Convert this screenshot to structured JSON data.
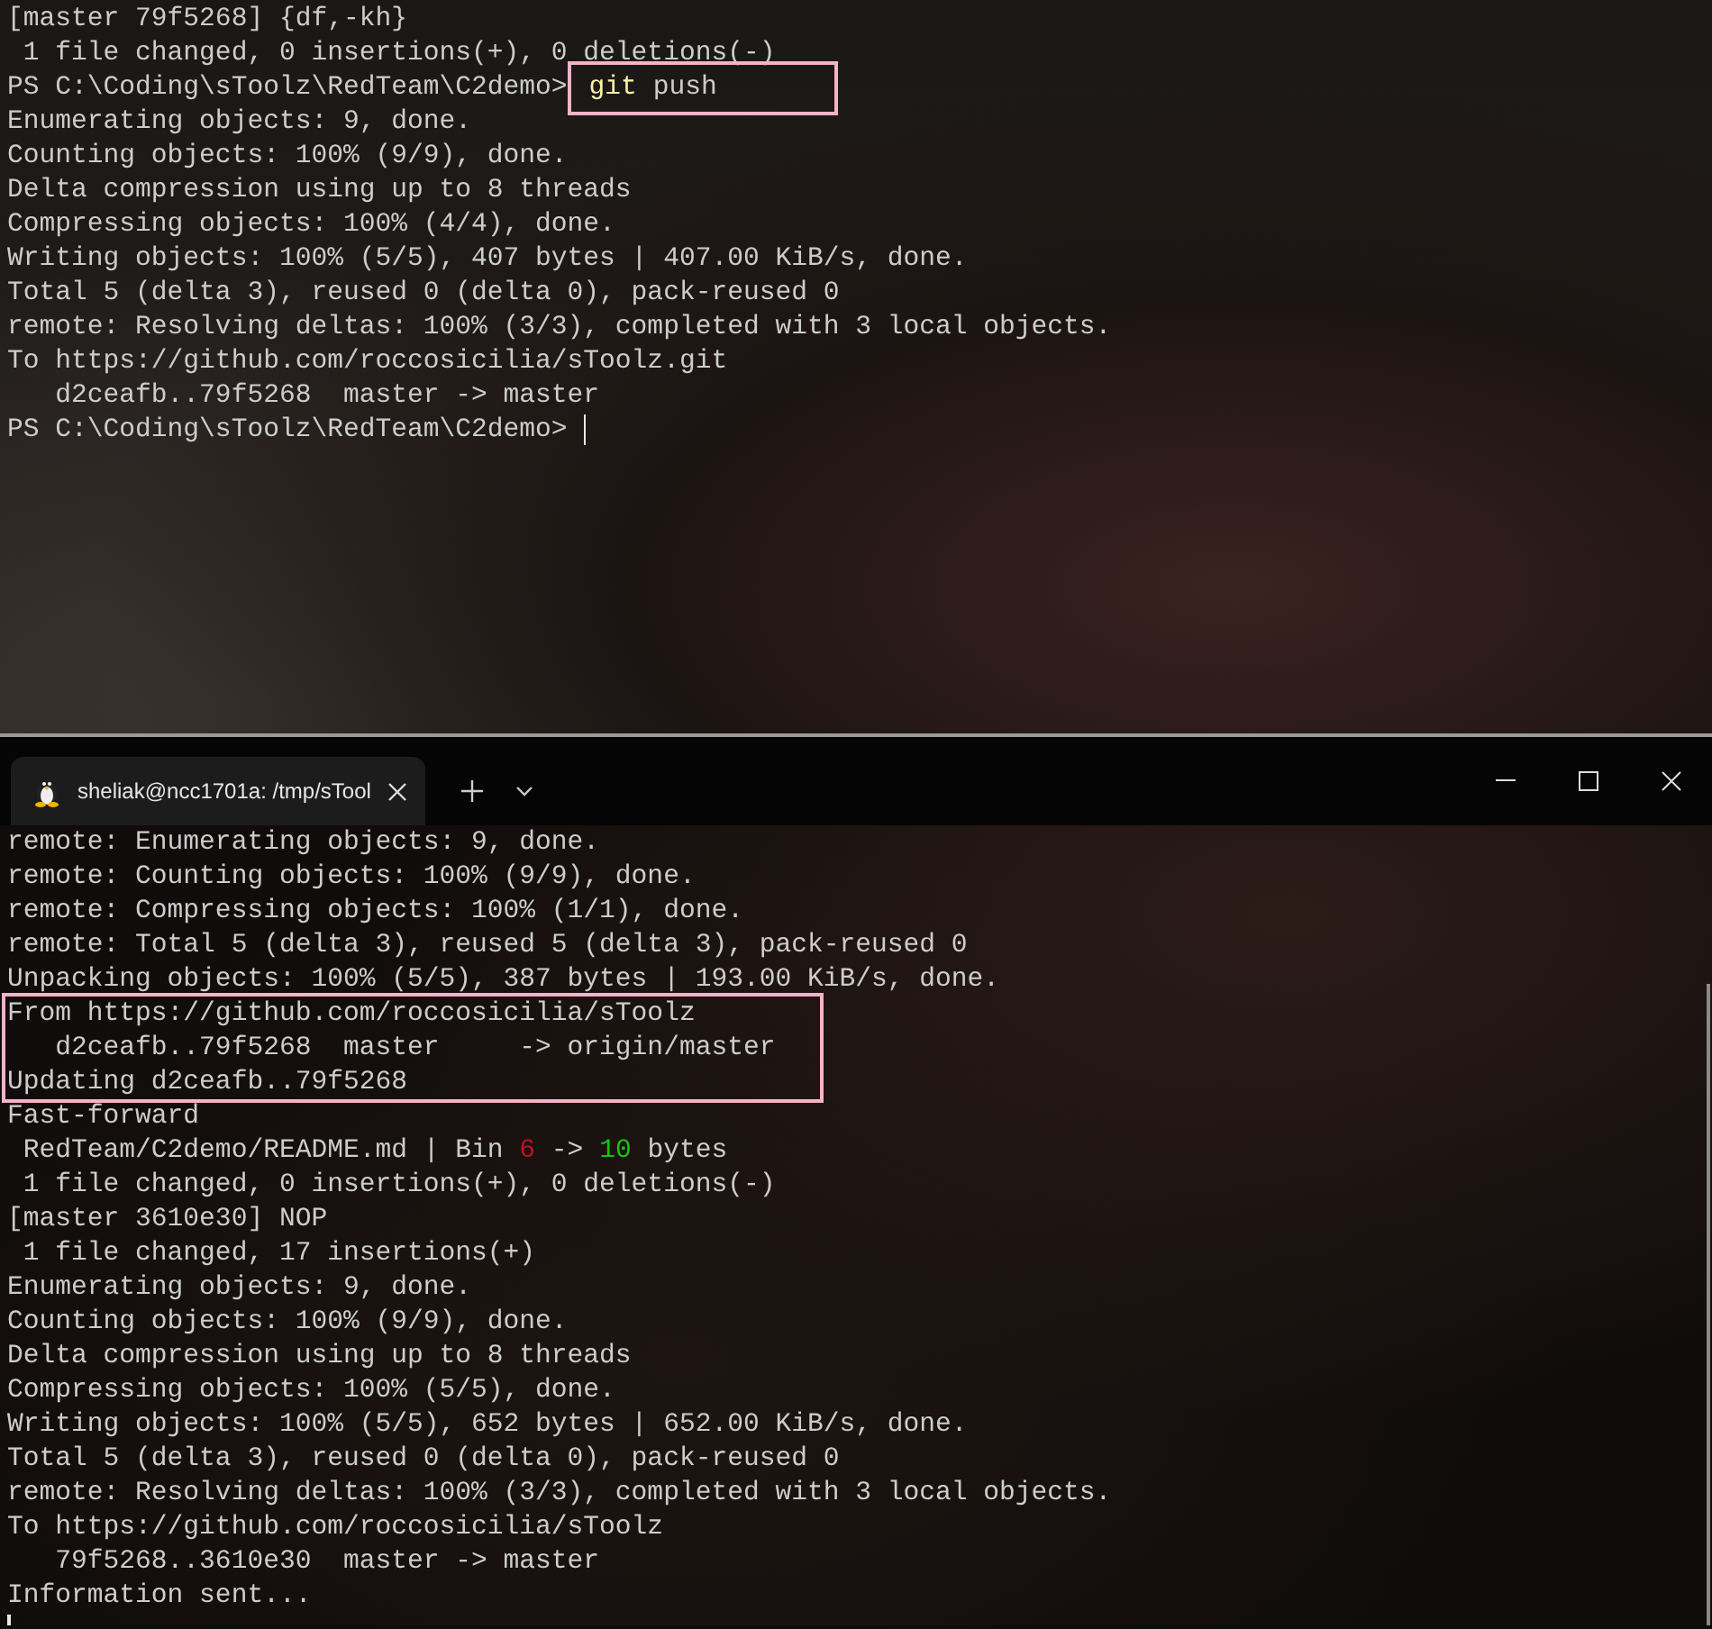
{
  "top_terminal": {
    "lines": [
      {
        "segments": [
          {
            "text": "[master 79f5268] {df,-kh}",
            "kind": "plain"
          }
        ]
      },
      {
        "segments": [
          {
            "text": " 1 file changed, 0 insertions(+), 0 deletions(-)",
            "kind": "plain"
          }
        ]
      },
      {
        "prompt": "PS C:\\Coding\\sToolz\\RedTeam\\C2demo>",
        "command": [
          {
            "text": "git",
            "kind": "executable"
          },
          {
            "text": "push",
            "kind": "argument"
          }
        ],
        "boxed": true
      },
      {
        "segments": [
          {
            "text": "Enumerating objects: 9, done.",
            "kind": "plain"
          }
        ]
      },
      {
        "segments": [
          {
            "text": "Counting objects: 100% (9/9), done.",
            "kind": "plain"
          }
        ]
      },
      {
        "segments": [
          {
            "text": "Delta compression using up to 8 threads",
            "kind": "plain"
          }
        ]
      },
      {
        "segments": [
          {
            "text": "Compressing objects: 100% (4/4), done.",
            "kind": "plain"
          }
        ]
      },
      {
        "segments": [
          {
            "text": "Writing objects: 100% (5/5), 407 bytes | 407.00 KiB/s, done.",
            "kind": "plain"
          }
        ]
      },
      {
        "segments": [
          {
            "text": "Total 5 (delta 3), reused 0 (delta 0), pack-reused 0",
            "kind": "plain"
          }
        ]
      },
      {
        "segments": [
          {
            "text": "remote: Resolving deltas: 100% (3/3), completed with 3 local objects.",
            "kind": "plain"
          }
        ]
      },
      {
        "segments": [
          {
            "text": "To https://github.com/roccosicilia/sToolz.git",
            "kind": "plain"
          }
        ]
      },
      {
        "segments": [
          {
            "text": "   d2ceafb..79f5268  master -> master",
            "kind": "plain"
          }
        ]
      },
      {
        "segments": [
          {
            "text": "PS C:\\Coding\\sToolz\\RedTeam\\C2demo> ",
            "kind": "plain"
          }
        ],
        "cursor": true
      }
    ]
  },
  "bottom_window": {
    "tab": {
      "title": "sheliak@ncc1701a: /tmp/sTool",
      "selected": true
    },
    "lines": [
      {
        "segments": [
          {
            "text": "remote: Enumerating objects: 9, done.",
            "kind": "plain"
          }
        ],
        "highlighted": false
      },
      {
        "segments": [
          {
            "text": "remote: Counting objects: 100% (9/9), done.",
            "kind": "plain"
          }
        ],
        "highlighted": false
      },
      {
        "segments": [
          {
            "text": "remote: Compressing objects: 100% (1/1), done.",
            "kind": "plain"
          }
        ],
        "highlighted": false
      },
      {
        "segments": [
          {
            "text": "remote: Total 5 (delta 3), reused 5 (delta 3), pack-reused 0",
            "kind": "plain"
          }
        ],
        "highlighted": false
      },
      {
        "segments": [
          {
            "text": "Unpacking objects: 100% (5/5), 387 bytes | 193.00 KiB/s, done.",
            "kind": "plain"
          }
        ],
        "highlighted": false
      },
      {
        "segments": [
          {
            "text": "From https://github.com/roccosicilia/sToolz",
            "kind": "plain"
          }
        ],
        "highlighted": true
      },
      {
        "segments": [
          {
            "text": "   d2ceafb..79f5268  master     -> origin/master",
            "kind": "plain"
          }
        ],
        "highlighted": true
      },
      {
        "segments": [
          {
            "text": "Updating d2ceafb..79f5268",
            "kind": "plain"
          }
        ],
        "highlighted": true
      },
      {
        "segments": [
          {
            "text": "Fast-forward",
            "kind": "plain"
          }
        ],
        "highlighted": false
      },
      {
        "segments": [
          {
            "text": " RedTeam/C2demo/README.md | Bin ",
            "kind": "plain"
          },
          {
            "text": "6",
            "kind": "removed"
          },
          {
            "text": " -> ",
            "kind": "plain"
          },
          {
            "text": "10",
            "kind": "added"
          },
          {
            "text": " bytes",
            "kind": "plain"
          }
        ],
        "highlighted": false
      },
      {
        "segments": [
          {
            "text": " 1 file changed, 0 insertions(+), 0 deletions(-)",
            "kind": "plain"
          }
        ],
        "highlighted": false
      },
      {
        "segments": [
          {
            "text": "[master 3610e30] NOP",
            "kind": "plain"
          }
        ],
        "highlighted": false
      },
      {
        "segments": [
          {
            "text": " 1 file changed, 17 insertions(+)",
            "kind": "plain"
          }
        ],
        "highlighted": false
      },
      {
        "segments": [
          {
            "text": "Enumerating objects: 9, done.",
            "kind": "plain"
          }
        ],
        "highlighted": false
      },
      {
        "segments": [
          {
            "text": "Counting objects: 100% (9/9), done.",
            "kind": "plain"
          }
        ],
        "highlighted": false
      },
      {
        "segments": [
          {
            "text": "Delta compression using up to 8 threads",
            "kind": "plain"
          }
        ],
        "highlighted": false
      },
      {
        "segments": [
          {
            "text": "Compressing objects: 100% (5/5), done.",
            "kind": "plain"
          }
        ],
        "highlighted": false
      },
      {
        "segments": [
          {
            "text": "Writing objects: 100% (5/5), 652 bytes | 652.00 KiB/s, done.",
            "kind": "plain"
          }
        ],
        "highlighted": false
      },
      {
        "segments": [
          {
            "text": "Total 5 (delta 3), reused 0 (delta 0), pack-reused 0",
            "kind": "plain"
          }
        ],
        "highlighted": false
      },
      {
        "segments": [
          {
            "text": "remote: Resolving deltas: 100% (3/3), completed with 3 local objects.",
            "kind": "plain"
          }
        ],
        "highlighted": false
      },
      {
        "segments": [
          {
            "text": "To https://github.com/roccosicilia/sToolz",
            "kind": "plain"
          }
        ],
        "highlighted": false
      },
      {
        "segments": [
          {
            "text": "   79f5268..3610e30  master -> master",
            "kind": "plain"
          }
        ],
        "highlighted": false
      },
      {
        "segments": [
          {
            "text": "Information sent...",
            "kind": "plain"
          }
        ],
        "highlighted": false
      },
      {
        "cursor": true,
        "highlighted": false
      }
    ]
  }
}
